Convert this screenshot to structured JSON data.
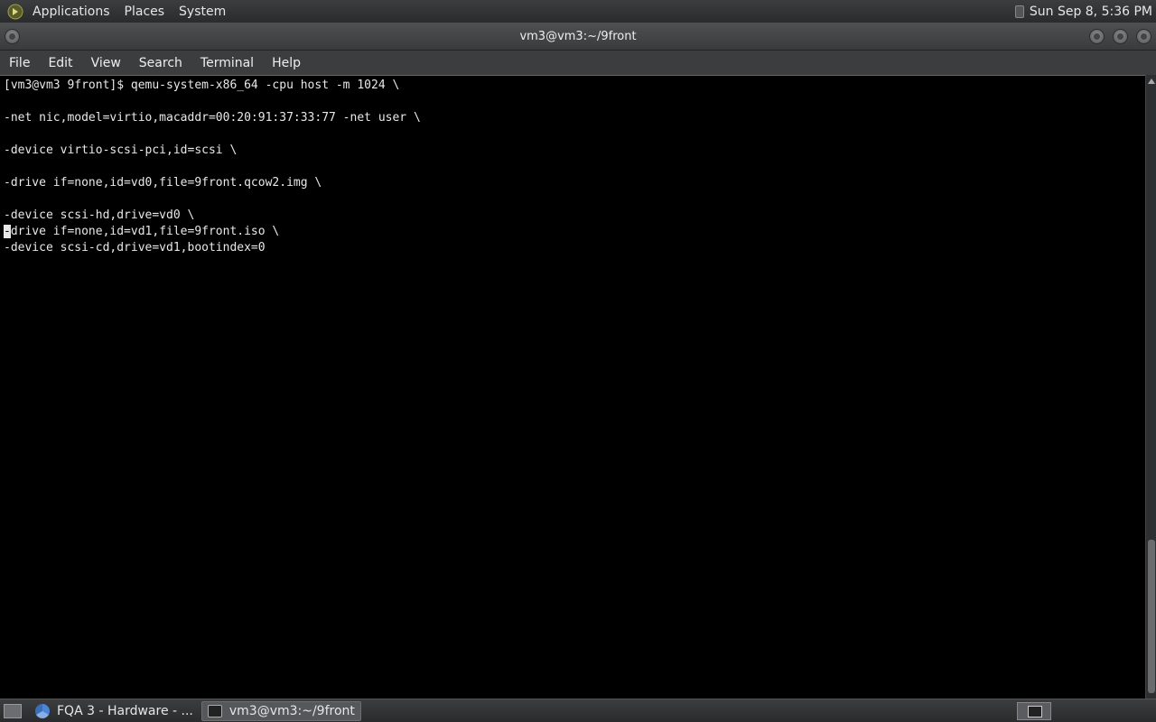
{
  "top_panel": {
    "menus": [
      "Applications",
      "Places",
      "System"
    ],
    "clock": "Sun Sep  8,  5:36 PM"
  },
  "window": {
    "title": "vm3@vm3:~/9front"
  },
  "menubar": [
    "File",
    "Edit",
    "View",
    "Search",
    "Terminal",
    "Help"
  ],
  "terminal": {
    "lines": [
      "[vm3@vm3 9front]$ qemu-system-x86_64 -cpu host -m 1024 \\",
      "",
      "-net nic,model=virtio,macaddr=00:20:91:37:33:77 -net user \\",
      "",
      "-device virtio-scsi-pci,id=scsi \\",
      "",
      "-drive if=none,id=vd0,file=9front.qcow2.img \\",
      "",
      "-device scsi-hd,drive=vd0 \\",
      "drive if=none,id=vd1,file=9front.iso \\",
      "-device scsi-cd,drive=vd1,bootindex=0"
    ],
    "cursor_char": "-"
  },
  "taskbar": {
    "tasks": [
      {
        "label": "FQA 3 - Hardware - ...",
        "icon": "chrome-icon"
      },
      {
        "label": "vm3@vm3:~/9front",
        "icon": "terminal-icon"
      }
    ]
  },
  "colors": {
    "panel": "#2f3032",
    "terminal_bg": "#000000",
    "terminal_fg": "#e8e8e8"
  }
}
